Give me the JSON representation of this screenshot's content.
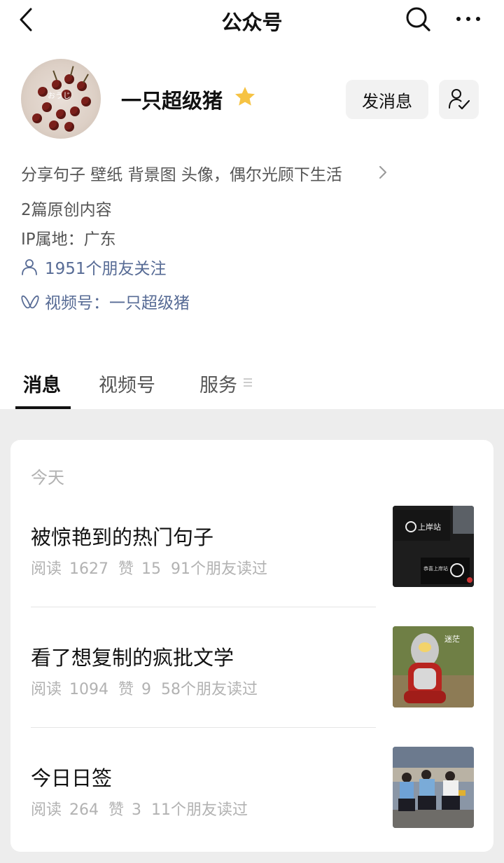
{
  "nav": {
    "title": "公众号",
    "back_icon": "chevron-left-icon",
    "search_icon": "search-icon",
    "more_icon": "more-dots-icon"
  },
  "profile": {
    "avatar_text": "おうじ",
    "name": "一只超级猪",
    "star_color": "#f6c344",
    "message_button": "发消息",
    "intro": "分享句子 壁纸 背景图 头像，偶尔光顾下生活",
    "original_count": "2篇原创内容",
    "ip_location": "IP属地：广东",
    "friends_following": "1951个朋友关注",
    "channels": "视频号：一只超级猪",
    "link_color": "#576b95"
  },
  "tabs": [
    {
      "label": "消息",
      "active": true
    },
    {
      "label": "视频号",
      "active": false
    },
    {
      "label": "服务",
      "active": false
    }
  ],
  "feed": {
    "day_label": "今天",
    "articles": [
      {
        "title": "被惊艳到的热门句子",
        "reads": "阅读 1627",
        "likes": "赞 15",
        "friends_read": "91个朋友读过",
        "thumb_text": "上岸站",
        "thumb_text2": "恭喜上岸站"
      },
      {
        "title": "看了想复制的疯批文学",
        "reads": "阅读 1094",
        "likes": "赞 9",
        "friends_read": "58个朋友读过",
        "thumb_text": "迷茫"
      },
      {
        "title": "今日日签",
        "reads": "阅读 264",
        "likes": "赞 3",
        "friends_read": "11个朋友读过"
      }
    ]
  }
}
